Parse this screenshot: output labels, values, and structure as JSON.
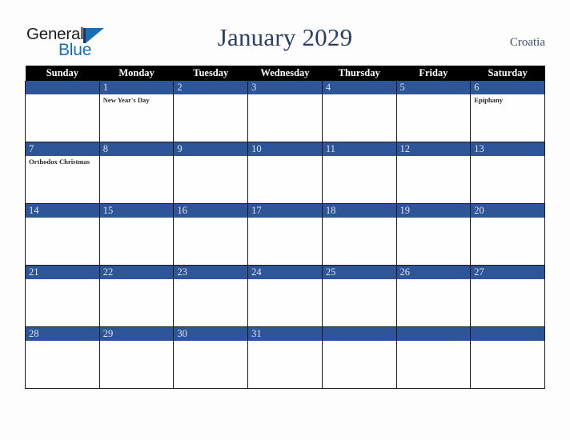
{
  "logo": {
    "line1": "General",
    "line2": "Blue",
    "triangle_color": "#1570b8",
    "text_color": "#1b1b1b"
  },
  "header": {
    "title": "January 2029",
    "country": "Croatia",
    "title_color": "#2b3f66"
  },
  "calendar": {
    "weekday_headers": [
      "Sunday",
      "Monday",
      "Tuesday",
      "Wednesday",
      "Thursday",
      "Friday",
      "Saturday"
    ],
    "header_bg": "#000000",
    "daybar_bg": "#2e5597",
    "weeks": [
      [
        {
          "day": "",
          "holiday": ""
        },
        {
          "day": "1",
          "holiday": "New Year's Day"
        },
        {
          "day": "2",
          "holiday": ""
        },
        {
          "day": "3",
          "holiday": ""
        },
        {
          "day": "4",
          "holiday": ""
        },
        {
          "day": "5",
          "holiday": ""
        },
        {
          "day": "6",
          "holiday": "Epiphany"
        }
      ],
      [
        {
          "day": "7",
          "holiday": "Orthodox Christmas"
        },
        {
          "day": "8",
          "holiday": ""
        },
        {
          "day": "9",
          "holiday": ""
        },
        {
          "day": "10",
          "holiday": ""
        },
        {
          "day": "11",
          "holiday": ""
        },
        {
          "day": "12",
          "holiday": ""
        },
        {
          "day": "13",
          "holiday": ""
        }
      ],
      [
        {
          "day": "14",
          "holiday": ""
        },
        {
          "day": "15",
          "holiday": ""
        },
        {
          "day": "16",
          "holiday": ""
        },
        {
          "day": "17",
          "holiday": ""
        },
        {
          "day": "18",
          "holiday": ""
        },
        {
          "day": "19",
          "holiday": ""
        },
        {
          "day": "20",
          "holiday": ""
        }
      ],
      [
        {
          "day": "21",
          "holiday": ""
        },
        {
          "day": "22",
          "holiday": ""
        },
        {
          "day": "23",
          "holiday": ""
        },
        {
          "day": "24",
          "holiday": ""
        },
        {
          "day": "25",
          "holiday": ""
        },
        {
          "day": "26",
          "holiday": ""
        },
        {
          "day": "27",
          "holiday": ""
        }
      ],
      [
        {
          "day": "28",
          "holiday": ""
        },
        {
          "day": "29",
          "holiday": ""
        },
        {
          "day": "30",
          "holiday": ""
        },
        {
          "day": "31",
          "holiday": ""
        },
        {
          "day": "",
          "holiday": ""
        },
        {
          "day": "",
          "holiday": ""
        },
        {
          "day": "",
          "holiday": ""
        }
      ]
    ]
  }
}
